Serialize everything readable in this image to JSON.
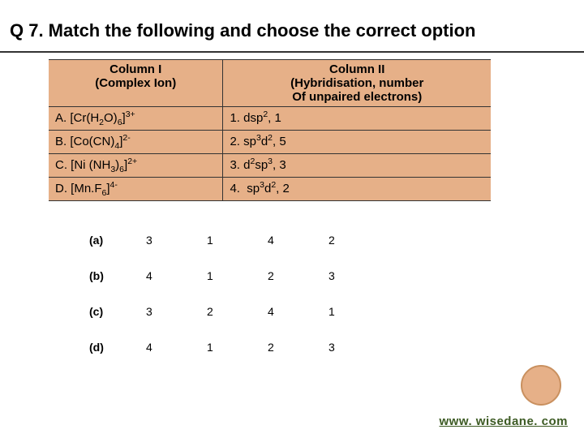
{
  "title": "Q 7. Match the following and choose the correct option",
  "columns": {
    "col1_l1": "Column I",
    "col1_l2": "(Complex Ion)",
    "col2_l1": "Column II",
    "col2_l2": "(Hybridisation, number",
    "col2_l3": "Of unpaired electrons)"
  },
  "rows": {
    "a_l": "A. [Cr(H₂O)₆]³⁺",
    "a_r": "1. dsp², 1",
    "b_l": "B. [Co(CN)₄]²⁻",
    "b_r": "2. sp³d², 5",
    "c_l": "C. [Ni (NH₃)₆]²⁺",
    "c_r": "3. d²sp³, 3",
    "d_l": "D. [Mn.F₆]⁴⁻",
    "d_r": "4.  sp³d², 2"
  },
  "options": [
    {
      "label": "(a)",
      "vals": [
        "3",
        "1",
        "4",
        "2"
      ]
    },
    {
      "label": "(b)",
      "vals": [
        "4",
        "1",
        "2",
        "3"
      ]
    },
    {
      "label": "(c)",
      "vals": [
        "3",
        "2",
        "4",
        "1"
      ]
    },
    {
      "label": "(d)",
      "vals": [
        "4",
        "1",
        "2",
        "3"
      ]
    }
  ],
  "footer": "www. wisedane. com"
}
